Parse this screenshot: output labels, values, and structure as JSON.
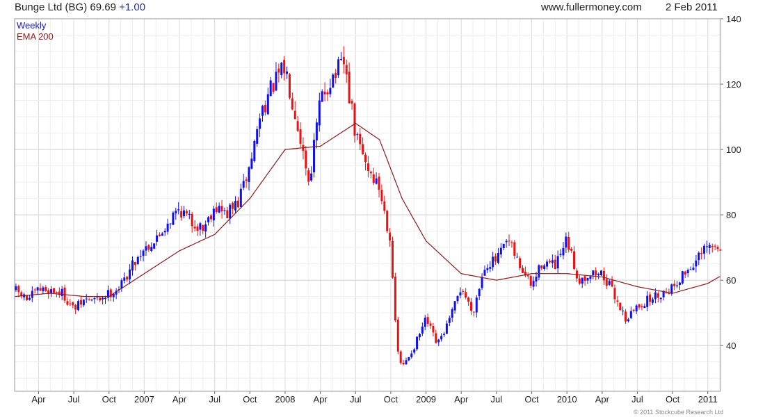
{
  "header": {
    "security": "Bunge Ltd (BG)",
    "price": "69.69",
    "change": "+1.00",
    "site": "www.fullermoney.com",
    "date": "2 Feb 2011"
  },
  "legend": {
    "weekly": "Weekly",
    "ema": "EMA 200"
  },
  "footer": {
    "copyright": "© 2011 Stockcube Research Ltd"
  },
  "colors": {
    "up": "#1010ee",
    "down": "#ee1010",
    "ema": "#8b1a1a",
    "grid": "#dddddd",
    "frame": "#999999"
  },
  "chart_data": {
    "type": "candlestick",
    "series": [
      {
        "name": "Weekly",
        "type": "candlestick"
      },
      {
        "name": "EMA 200",
        "type": "line"
      }
    ],
    "y_ticks": [
      40,
      60,
      80,
      100,
      120,
      140
    ],
    "ylim": [
      26,
      140
    ],
    "x_tick_labels": [
      "Apr",
      "Jul",
      "Oct",
      "2007",
      "Apr",
      "Jul",
      "Oct",
      "2008",
      "Apr",
      "Jul",
      "Oct",
      "2009",
      "Apr",
      "Jul",
      "Oct",
      "2010",
      "Apr",
      "Jul",
      "Oct",
      "2011"
    ],
    "x_range": [
      "2006-02",
      "2011-02"
    ],
    "close_path": [
      [
        2006.08,
        57
      ],
      [
        2006.17,
        54
      ],
      [
        2006.25,
        57
      ],
      [
        2006.33,
        57
      ],
      [
        2006.42,
        56
      ],
      [
        2006.5,
        51
      ],
      [
        2006.58,
        54
      ],
      [
        2006.67,
        54
      ],
      [
        2006.75,
        56
      ],
      [
        2006.83,
        58
      ],
      [
        2006.92,
        65
      ],
      [
        2007.0,
        70
      ],
      [
        2007.08,
        72
      ],
      [
        2007.17,
        78
      ],
      [
        2007.25,
        82
      ],
      [
        2007.33,
        78
      ],
      [
        2007.42,
        76
      ],
      [
        2007.5,
        83
      ],
      [
        2007.58,
        80
      ],
      [
        2007.67,
        84
      ],
      [
        2007.75,
        95
      ],
      [
        2007.83,
        112
      ],
      [
        2007.92,
        120
      ],
      [
        2008.0,
        125
      ],
      [
        2008.08,
        110
      ],
      [
        2008.17,
        90
      ],
      [
        2008.25,
        115
      ],
      [
        2008.33,
        122
      ],
      [
        2008.42,
        126
      ],
      [
        2008.5,
        104
      ],
      [
        2008.58,
        95
      ],
      [
        2008.67,
        88
      ],
      [
        2008.75,
        72
      ],
      [
        2008.79,
        40
      ],
      [
        2008.83,
        33
      ],
      [
        2008.92,
        40
      ],
      [
        2009.0,
        48
      ],
      [
        2009.08,
        40
      ],
      [
        2009.17,
        48
      ],
      [
        2009.25,
        58
      ],
      [
        2009.33,
        50
      ],
      [
        2009.42,
        65
      ],
      [
        2009.5,
        66
      ],
      [
        2009.58,
        72
      ],
      [
        2009.67,
        64
      ],
      [
        2009.75,
        58
      ],
      [
        2009.83,
        66
      ],
      [
        2009.92,
        64
      ],
      [
        2010.0,
        72
      ],
      [
        2010.08,
        60
      ],
      [
        2010.17,
        62
      ],
      [
        2010.25,
        62
      ],
      [
        2010.33,
        56
      ],
      [
        2010.42,
        48
      ],
      [
        2010.5,
        52
      ],
      [
        2010.58,
        54
      ],
      [
        2010.67,
        56
      ],
      [
        2010.75,
        58
      ],
      [
        2010.83,
        62
      ],
      [
        2010.92,
        66
      ],
      [
        2011.0,
        70
      ],
      [
        2011.08,
        69.69
      ]
    ],
    "ema_path": [
      [
        2006.08,
        55
      ],
      [
        2006.33,
        56
      ],
      [
        2006.58,
        55
      ],
      [
        2006.75,
        55
      ],
      [
        2007.0,
        62
      ],
      [
        2007.25,
        69
      ],
      [
        2007.5,
        74
      ],
      [
        2007.75,
        85
      ],
      [
        2008.0,
        100
      ],
      [
        2008.25,
        101
      ],
      [
        2008.5,
        108
      ],
      [
        2008.67,
        103
      ],
      [
        2008.83,
        85
      ],
      [
        2009.0,
        72
      ],
      [
        2009.25,
        62
      ],
      [
        2009.5,
        60
      ],
      [
        2009.75,
        62
      ],
      [
        2010.0,
        62
      ],
      [
        2010.25,
        61
      ],
      [
        2010.5,
        58
      ],
      [
        2010.75,
        56
      ],
      [
        2011.0,
        59
      ],
      [
        2011.08,
        61
      ]
    ],
    "last_price": 69.69,
    "price_change": 1.0
  }
}
